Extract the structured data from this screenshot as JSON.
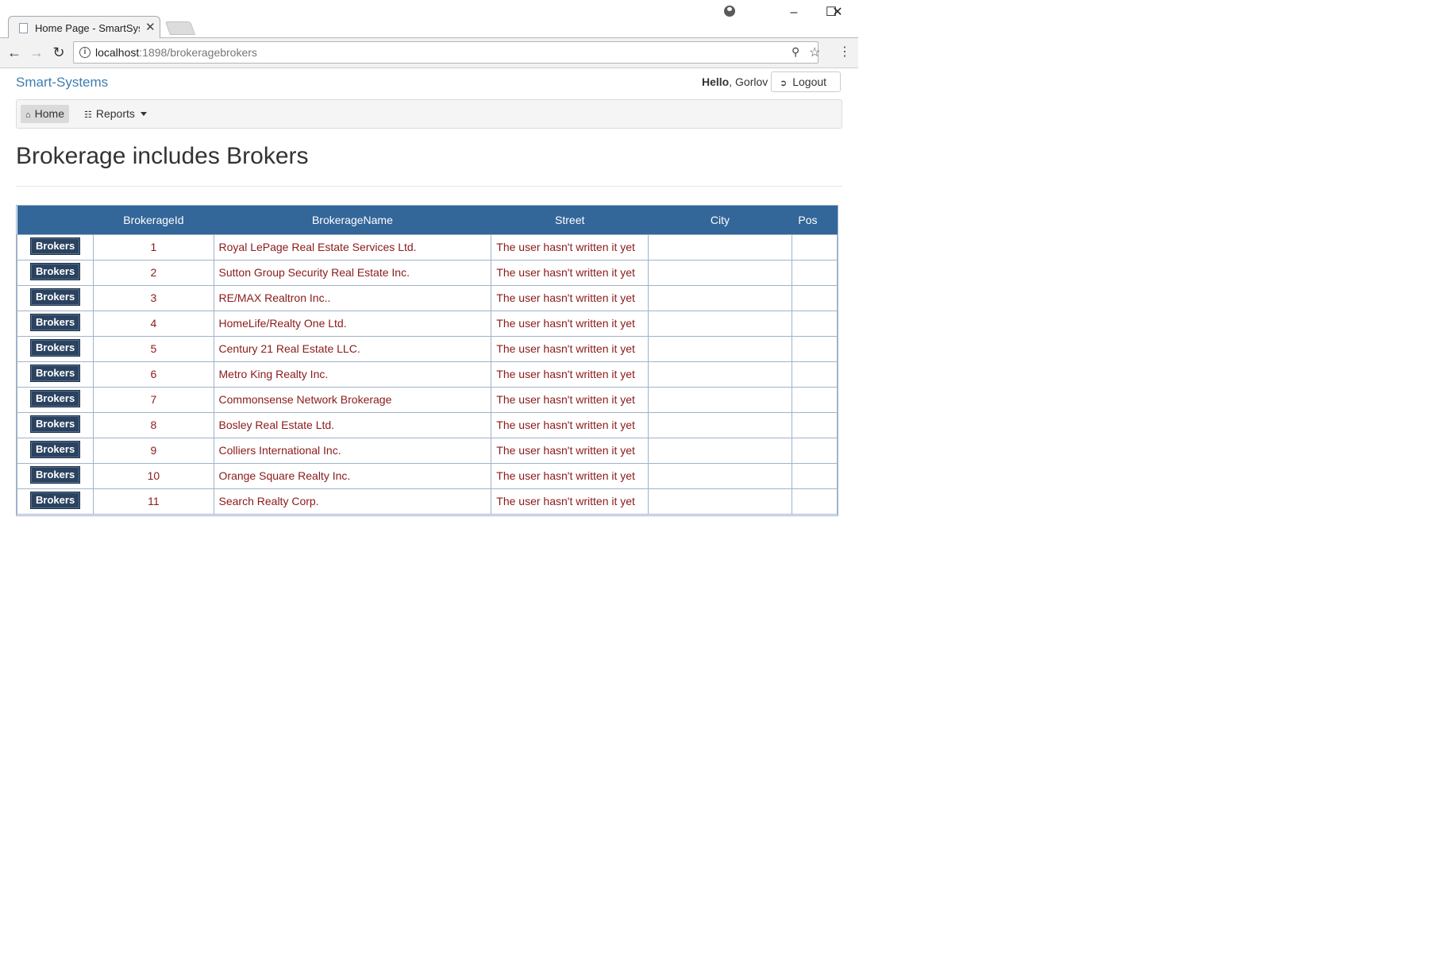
{
  "browser": {
    "tab_title": "Home Page - SmartSyste",
    "url_host": "localhost",
    "url_path": ":1898/brokeragebrokers"
  },
  "header": {
    "brand": "Smart-Systems",
    "hello_label": "Hello",
    "user_name": ", Gorlov",
    "logout_label": "Logout"
  },
  "nav": {
    "home_label": "Home",
    "reports_label": "Reports"
  },
  "main": {
    "title": "Brokerage includes Brokers"
  },
  "table": {
    "columns": [
      "",
      "BrokerageId",
      "BrokerageName",
      "Street",
      "City",
      "Pos"
    ],
    "button_label": "Brokers",
    "rows": [
      {
        "id": "1",
        "name": "Royal LePage Real Estate Services Ltd.",
        "street": "The user hasn't written it yet",
        "city": "",
        "pos": ""
      },
      {
        "id": "2",
        "name": "Sutton Group Security Real Estate Inc.",
        "street": "The user hasn't written it yet",
        "city": "",
        "pos": ""
      },
      {
        "id": "3",
        "name": "RE/MAX Realtron Inc..",
        "street": "The user hasn't written it yet",
        "city": "",
        "pos": ""
      },
      {
        "id": "4",
        "name": "HomeLife/Realty One Ltd.",
        "street": "The user hasn't written it yet",
        "city": "",
        "pos": ""
      },
      {
        "id": "5",
        "name": "Century 21 Real Estate LLC.",
        "street": "The user hasn't written it yet",
        "city": "",
        "pos": ""
      },
      {
        "id": "6",
        "name": "Metro King Realty Inc.",
        "street": "The user hasn't written it yet",
        "city": "",
        "pos": ""
      },
      {
        "id": "7",
        "name": "Commonsense Network Brokerage",
        "street": "The user hasn't written it yet",
        "city": "",
        "pos": ""
      },
      {
        "id": "8",
        "name": "Bosley Real Estate Ltd.",
        "street": "The user hasn't written it yet",
        "city": "",
        "pos": ""
      },
      {
        "id": "9",
        "name": "Colliers International Inc.",
        "street": "The user hasn't written it yet",
        "city": "",
        "pos": ""
      },
      {
        "id": "10",
        "name": "Orange Square Realty Inc.",
        "street": "The user hasn't written it yet",
        "city": "",
        "pos": ""
      },
      {
        "id": "11",
        "name": "Search Realty Corp.",
        "street": "The user hasn't written it yet",
        "city": "",
        "pos": ""
      }
    ]
  },
  "icons": {
    "tab_close": "close-icon",
    "back": "arrow-left-icon",
    "forward": "arrow-right-icon",
    "reload": "reload-icon",
    "info": "info-icon",
    "key": "key-icon",
    "bookmark": "star-icon",
    "menu": "kebab-menu-icon",
    "profile": "profile-icon",
    "minimize": "minimize-icon",
    "maximize": "maximize-icon",
    "close_window": "close-window-icon",
    "home": "home-icon",
    "reports": "sitemap-icon",
    "logout": "logout-icon"
  },
  "colors": {
    "brand": "#3e7eb0",
    "table_header": "#336699",
    "cell_text": "#8b1a1a",
    "button_bg": "#2b4360"
  }
}
